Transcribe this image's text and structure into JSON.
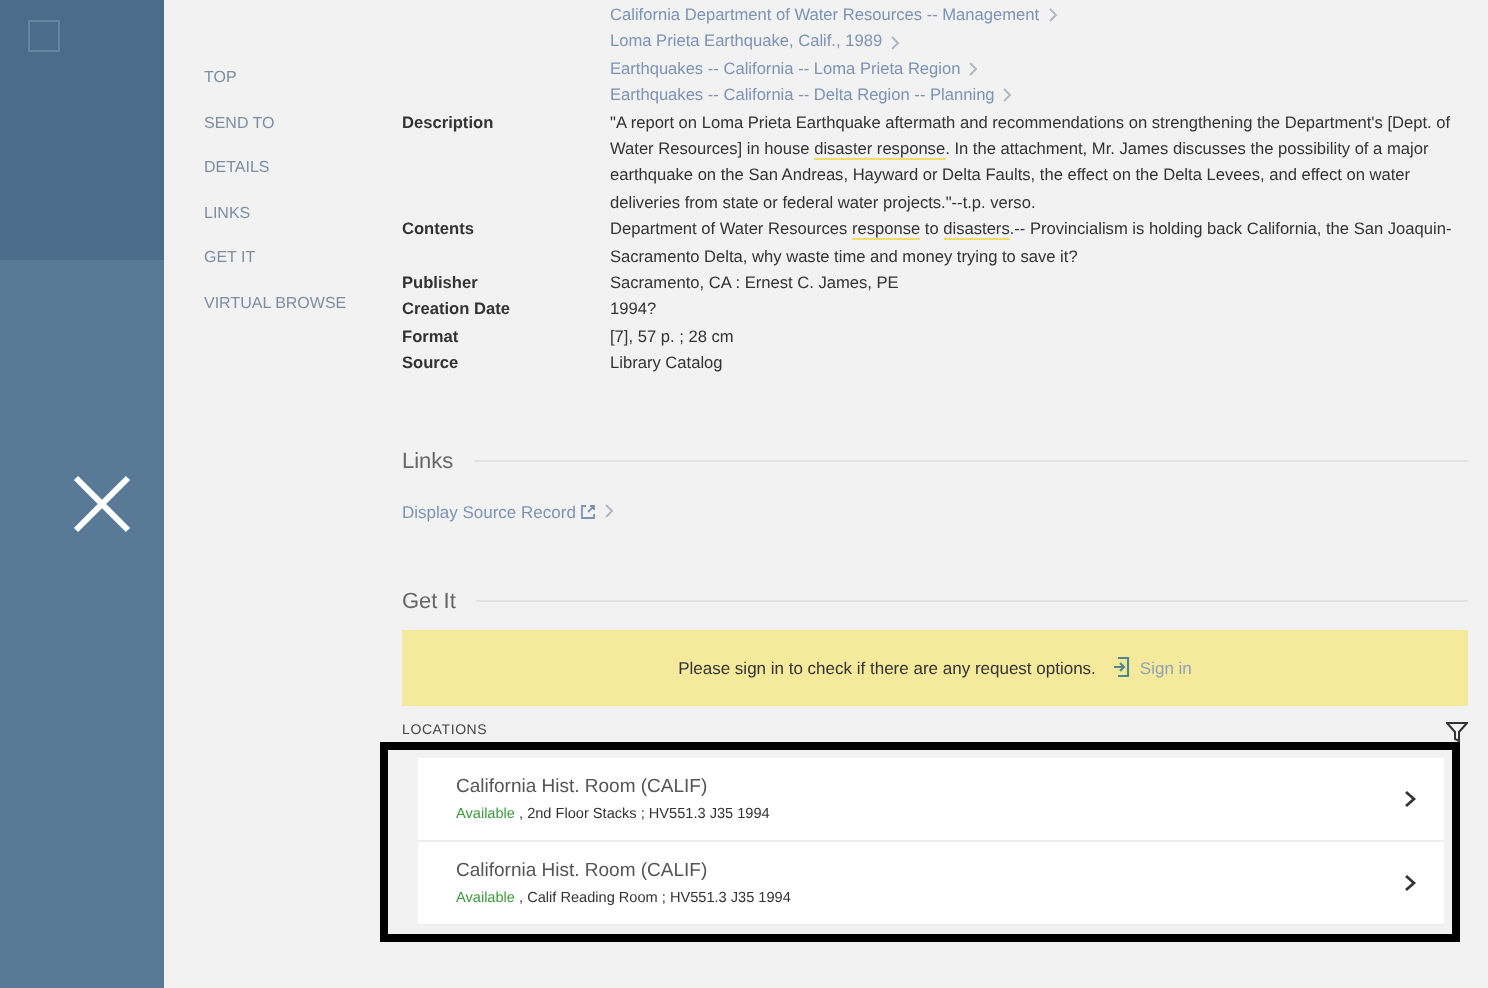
{
  "nav": [
    {
      "label": "TOP"
    },
    {
      "label": "SEND TO"
    },
    {
      "label": "DETAILS"
    },
    {
      "label": "LINKS"
    },
    {
      "label": "GET IT"
    },
    {
      "label": "VIRTUAL BROWSE"
    }
  ],
  "details": {
    "subjects": [
      "California Department of Water Resources -- Management",
      "Loma Prieta Earthquake, Calif., 1989",
      "Earthquakes -- California -- Loma Prieta Region",
      "Earthquakes -- California -- Delta Region -- Planning"
    ],
    "fields": [
      {
        "label": "Description",
        "value": [
          {
            "text": "\"A report on Loma Prieta Earthquake aftermath and recommendations on strengthening the Department's [Dept. of Water Resources] in house ",
            "highlighted": false
          },
          {
            "text": "disaster response",
            "highlighted": true
          },
          {
            "text": ". In the attachment, Mr. James discusses the possibility of a major earthquake on the San Andreas, Hayward or Delta Faults, the effect on the Delta Levees, and effect on water deliveries from state or federal water projects.\"--t.p. verso.",
            "highlighted": false
          }
        ]
      },
      {
        "label": "Contents",
        "value": [
          {
            "text": "Department of Water Resources ",
            "highlighted": false
          },
          {
            "text": "response",
            "highlighted": true
          },
          {
            "text": " to ",
            "highlighted": false
          },
          {
            "text": "disasters",
            "highlighted": true
          },
          {
            "text": ".-- Provincialism is holding back California, the San Joaquin-Sacramento Delta, why waste time and money trying to save it?",
            "highlighted": false
          }
        ]
      },
      {
        "label": "Publisher",
        "value": [
          {
            "text": "Sacramento, CA : Ernest C. James, PE",
            "highlighted": false
          }
        ]
      },
      {
        "label": "Creation Date",
        "value": [
          {
            "text": "1994?",
            "highlighted": false
          }
        ]
      },
      {
        "label": "Format",
        "value": [
          {
            "text": "[7], 57 p. ; 28 cm",
            "highlighted": false
          }
        ]
      },
      {
        "label": "Source",
        "value": [
          {
            "text": "Library Catalog",
            "highlighted": false
          }
        ]
      }
    ]
  },
  "links": {
    "heading": "Links",
    "items": [
      {
        "label": "Display Source Record"
      }
    ]
  },
  "get_it": {
    "heading": "Get It",
    "banner": {
      "message": "Please sign in to check if there are any request options.",
      "action": "Sign in"
    },
    "locations_label": "LOCATIONS",
    "locations": [
      {
        "name": "California Hist. Room (CALIF)",
        "status": "Available",
        "details": ", 2nd Floor Stacks ; HV551.3 J35 1994"
      },
      {
        "name": "California Hist. Room (CALIF)",
        "status": "Available",
        "details": ", Calif Reading Room ; HV551.3 J35 1994"
      }
    ]
  }
}
